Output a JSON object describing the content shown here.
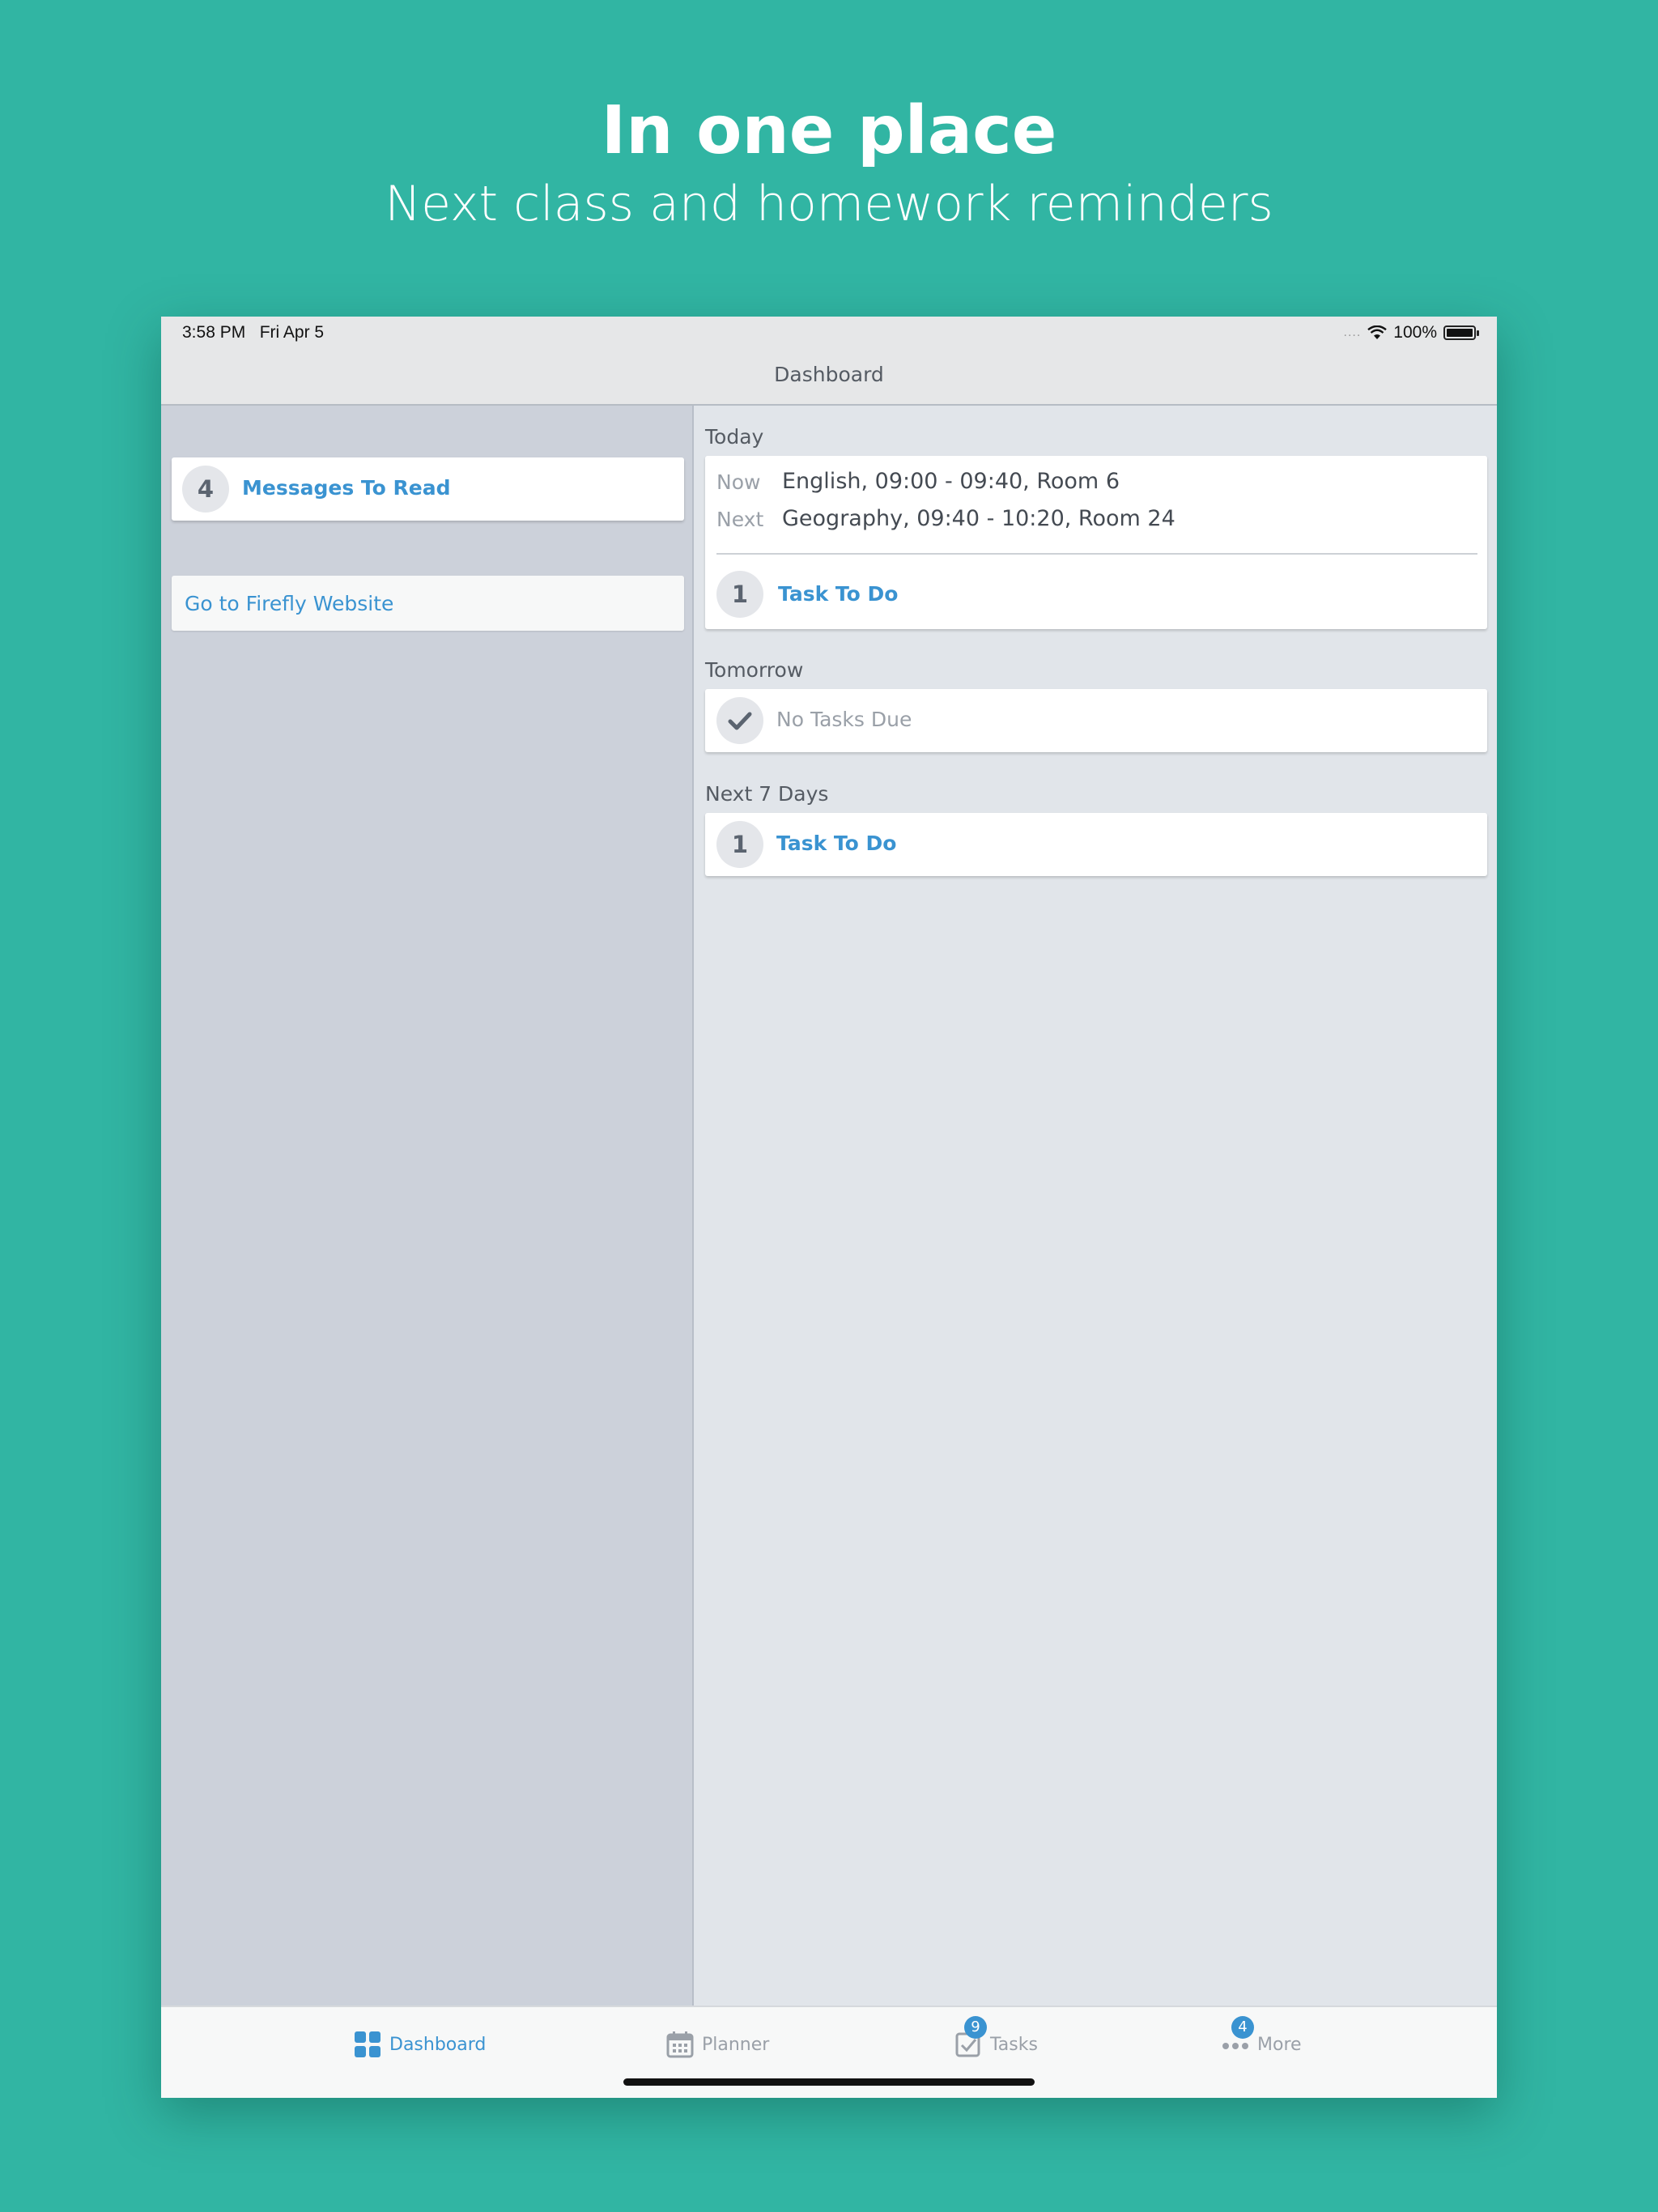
{
  "promo": {
    "title": "In one place",
    "subtitle": "Next class and homework reminders"
  },
  "status_bar": {
    "time": "3:58 PM",
    "date": "Fri Apr 5",
    "signal": "....",
    "battery": "100%",
    "battery_level": 1.0
  },
  "navbar": {
    "title": "Dashboard"
  },
  "sidebar": {
    "messages": {
      "count": "4",
      "label": "Messages To Read"
    },
    "website_link": "Go to Firefly Website"
  },
  "main": {
    "today": {
      "label": "Today",
      "now_key": "Now",
      "now_value": "English, 09:00 - 09:40, Room 6",
      "next_key": "Next",
      "next_value": "Geography, 09:40 - 10:20, Room 24",
      "task_count": "1",
      "task_label": "Task To Do"
    },
    "tomorrow": {
      "label": "Tomorrow",
      "no_tasks": "No Tasks Due"
    },
    "next7": {
      "label": "Next 7 Days",
      "task_count": "1",
      "task_label": "Task To Do"
    }
  },
  "tabs": [
    {
      "label": "Dashboard",
      "icon": "dashboard-grid-icon",
      "active": true
    },
    {
      "label": "Planner",
      "icon": "calendar-icon",
      "active": false
    },
    {
      "label": "Tasks",
      "icon": "checkbox-icon",
      "badge": "9",
      "active": false
    },
    {
      "label": "More",
      "icon": "more-dots-icon",
      "badge": "4",
      "active": false
    }
  ],
  "colors": {
    "background": "#31b5a3",
    "accent": "#3a93d1",
    "sidebar": "#ccd1da",
    "content": "#e1e5ea"
  }
}
